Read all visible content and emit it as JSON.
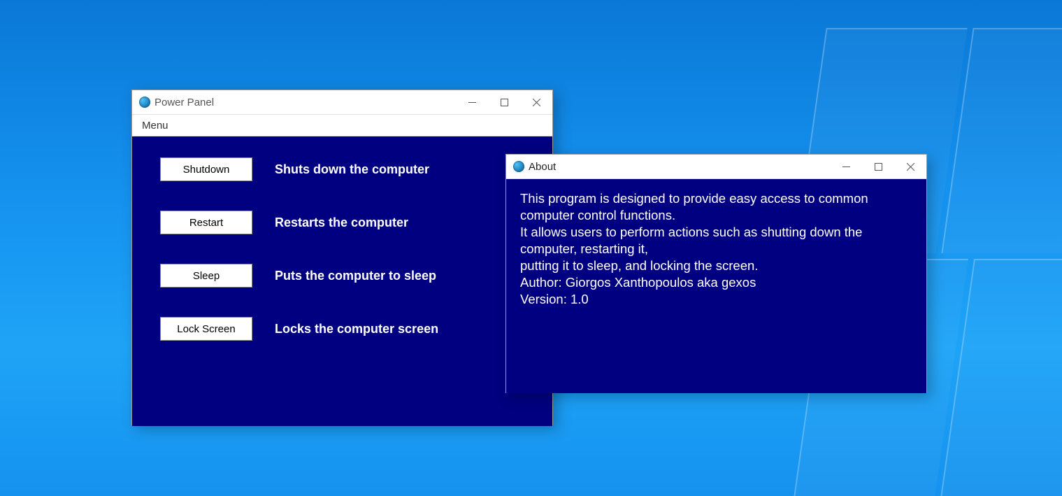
{
  "power_window": {
    "title": "Power Panel",
    "menu": {
      "item0": "Menu"
    },
    "actions": [
      {
        "button": "Shutdown",
        "desc": "Shuts down the computer"
      },
      {
        "button": "Restart",
        "desc": "Restarts the computer"
      },
      {
        "button": "Sleep",
        "desc": "Puts the computer to sleep"
      },
      {
        "button": "Lock Screen",
        "desc": "Locks the computer screen"
      }
    ]
  },
  "about_window": {
    "title": "About",
    "lines": [
      "This program is designed to provide easy access to common computer control functions.",
      "It allows users to perform actions such as shutting down the computer, restarting it,",
      "putting it to sleep, and locking the screen.",
      "Author: Giorgos Xanthopoulos aka gexos",
      "Version: 1.0"
    ]
  }
}
